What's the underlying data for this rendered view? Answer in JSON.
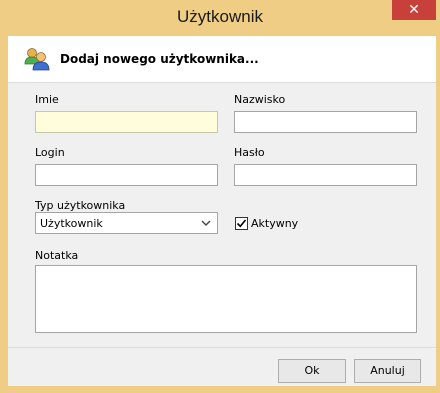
{
  "window": {
    "title": "Użytkownik",
    "close_glyph": "✕"
  },
  "header": {
    "icon": "users-icon",
    "text": "Dodaj nowego użytkownika..."
  },
  "form": {
    "imie_label": "Imie",
    "imie_value": "",
    "nazwisko_label": "Nazwisko",
    "nazwisko_value": "",
    "login_label": "Login",
    "login_value": "",
    "haslo_label": "Hasło",
    "haslo_value": "",
    "typ_label": "Typ użytkownika",
    "typ_value": "Użytkownik",
    "aktywny_label": "Aktywny",
    "aktywny_checked": true,
    "notatka_label": "Notatka",
    "notatka_value": ""
  },
  "buttons": {
    "ok": "Ok",
    "cancel": "Anuluj"
  },
  "colors": {
    "titlebar": "#f0cd84",
    "close": "#c8403a",
    "active_field": "#fffddb"
  }
}
